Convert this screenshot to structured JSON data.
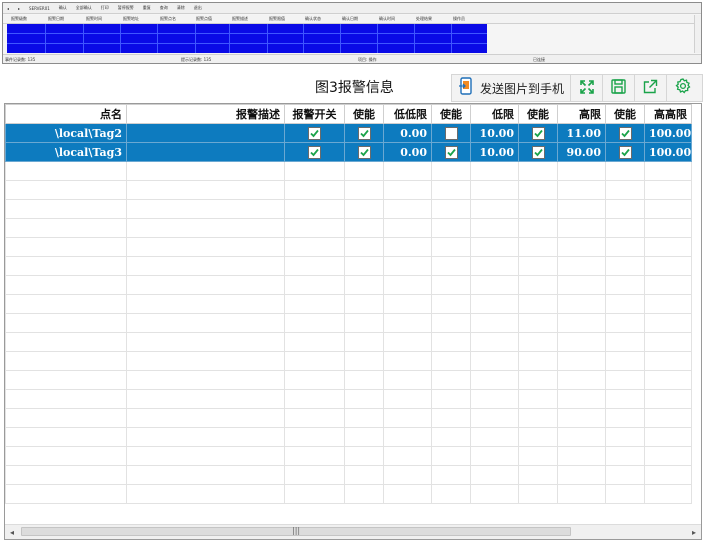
{
  "thumbnail": {
    "toolbar": [
      "◂",
      "▸",
      "SERVER01",
      "确认",
      "全部确认",
      "打印",
      "暂停报警",
      "重复",
      "查询",
      "清除",
      "退出"
    ],
    "columns": [
      "报警级数",
      "报警日期",
      "报警时间",
      "报警地址",
      "报警点名",
      "报警点值",
      "报警描述",
      "报警限值",
      "确认状态",
      "确认日期",
      "确认时间",
      "处理结果",
      "操作员"
    ],
    "status": [
      "事件记录数: 135",
      "提示记录数: 135",
      "项目: 操作",
      "已连接"
    ]
  },
  "caption": "图3报警信息",
  "toolbar": {
    "send_label": "发送图片到手机",
    "icons": [
      "phone-send-icon",
      "expand-icon",
      "save-icon",
      "share-icon",
      "settings-icon"
    ],
    "accent": "#1aa34a"
  },
  "table": {
    "headers": [
      "点名",
      "报警描述",
      "报警开关",
      "使能",
      "低低限",
      "使能",
      "低限",
      "使能",
      "高限",
      "使能",
      "高高限"
    ],
    "rows": [
      {
        "name": "\\local\\Tag2",
        "desc": "",
        "switch": true,
        "en1": true,
        "lolo": "0.00",
        "en2": false,
        "lo": "10.00",
        "en3": true,
        "hi": "11.00",
        "en4": true,
        "hihi": "100.00"
      },
      {
        "name": "\\local\\Tag3",
        "desc": "",
        "switch": true,
        "en1": true,
        "lolo": "0.00",
        "en2": true,
        "lo": "10.00",
        "en3": true,
        "hi": "90.00",
        "en4": true,
        "hihi": "100.00"
      }
    ],
    "selection_color": "#0d7bbf"
  },
  "scrollbar": {
    "left_arrow": "◂",
    "right_arrow": "▸",
    "grip": "|||"
  }
}
